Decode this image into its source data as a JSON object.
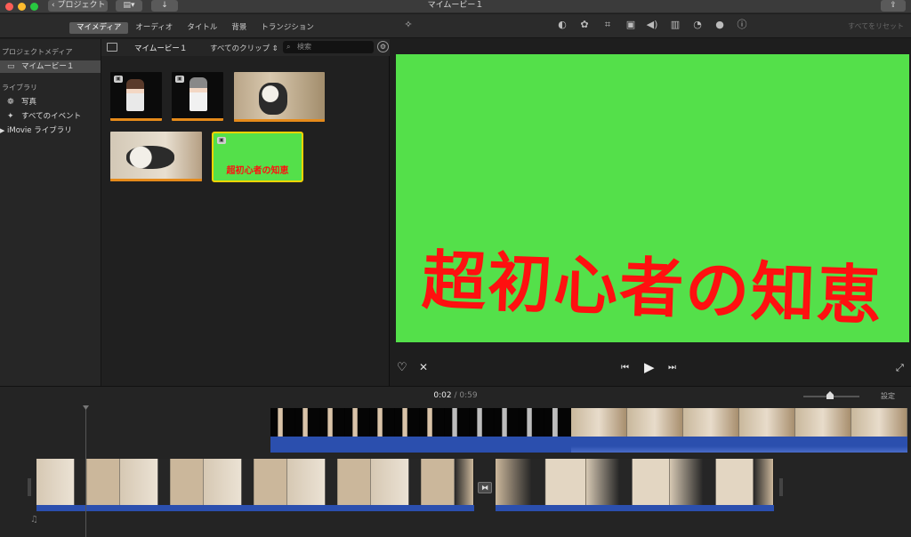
{
  "window": {
    "title": "マイムービー１",
    "back_label": "プロジェクト"
  },
  "toolbar": {
    "tabs": [
      {
        "label": "マイメディア",
        "active": true
      },
      {
        "label": "オーディオ",
        "active": false
      },
      {
        "label": "タイトル",
        "active": false
      },
      {
        "label": "背景",
        "active": false
      },
      {
        "label": "トランジション",
        "active": false
      }
    ],
    "reset_all": "すべてをリセット"
  },
  "sidebar": {
    "project_media_heading": "プロジェクトメディア",
    "project_item": "マイムービー１",
    "library_heading": "ライブラリ",
    "items": [
      {
        "label": "写真",
        "icon": "flower-icon"
      },
      {
        "label": "すべてのイベント",
        "icon": "star-icon"
      },
      {
        "label": "iMovie ライブラリ",
        "icon": "disclosure-triangle-icon"
      }
    ]
  },
  "browser": {
    "project_name": "マイムービー１",
    "filter": "すべてのクリップ",
    "search_placeholder": "検索",
    "title_clip_text": "超初心者の知恵"
  },
  "viewer": {
    "title_text": "超初心者の知恵",
    "background_color": "#54e04a",
    "text_color": "#ff1010"
  },
  "timeline": {
    "current_time": "0:02",
    "separator": "/",
    "total_time": "0:59",
    "settings_label": "設定"
  },
  "colors": {
    "audio": "#2b4fae",
    "accent": "#e58a1a"
  }
}
